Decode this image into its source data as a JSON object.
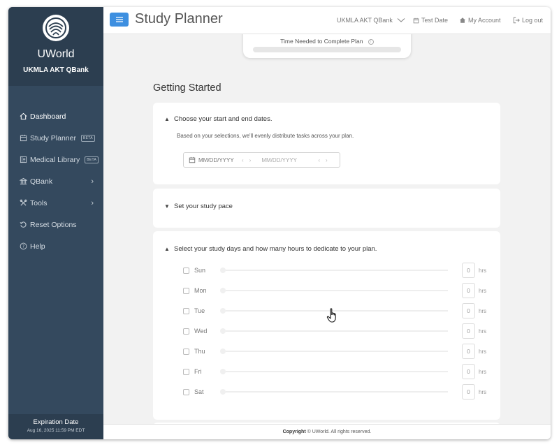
{
  "sidebar": {
    "brand": "UWorld",
    "subtitle": "UKMLA AKT QBank",
    "items": [
      {
        "label": "Dashboard",
        "icon": "home-icon"
      },
      {
        "label": "Study Planner",
        "icon": "calendar-icon",
        "badge": "BETA"
      },
      {
        "label": "Medical Library",
        "icon": "book-icon",
        "badge": "BETA"
      },
      {
        "label": "QBank",
        "icon": "bank-icon"
      },
      {
        "label": "Tools",
        "icon": "tools-icon"
      },
      {
        "label": "Reset Options",
        "icon": "reset-icon"
      },
      {
        "label": "Help",
        "icon": "help-icon"
      }
    ],
    "expiration_label": "Expiration Date",
    "expiration_date": "Aug 16, 2025 11:59 PM EDT"
  },
  "header": {
    "title": "Study Planner",
    "qbank_select": "UKMLA AKT QBank",
    "test_date": "Test Date",
    "my_account": "My Account",
    "logout": "Log out"
  },
  "main": {
    "time_needed": "Time Needed to Complete Plan",
    "section_title": "Getting Started",
    "dates_card": {
      "heading": "Choose your start and end dates.",
      "description": "Based on your selections, we'll evenly distribute tasks across your plan.",
      "start_placeholder": "MM/DD/YYYY",
      "end_placeholder": "MM/DD/YYYY"
    },
    "pace_card": {
      "heading": "Set your study pace"
    },
    "days_card": {
      "heading": "Select your study days and how many hours to dedicate to your plan.",
      "unit": "hrs",
      "days": [
        {
          "name": "Sun",
          "hours": "0"
        },
        {
          "name": "Mon",
          "hours": "0"
        },
        {
          "name": "Tue",
          "hours": "0"
        },
        {
          "name": "Wed",
          "hours": "0"
        },
        {
          "name": "Thu",
          "hours": "0"
        },
        {
          "name": "Fri",
          "hours": "0"
        },
        {
          "name": "Sat",
          "hours": "0"
        }
      ]
    }
  },
  "footer": {
    "copyright_bold": "Copyright",
    "copyright_rest": "© UWorld. All rights reserved."
  },
  "colors": {
    "sidebar": "#34495e",
    "sidebar_dark": "#2c3e50",
    "accent": "#3d8fe0"
  }
}
